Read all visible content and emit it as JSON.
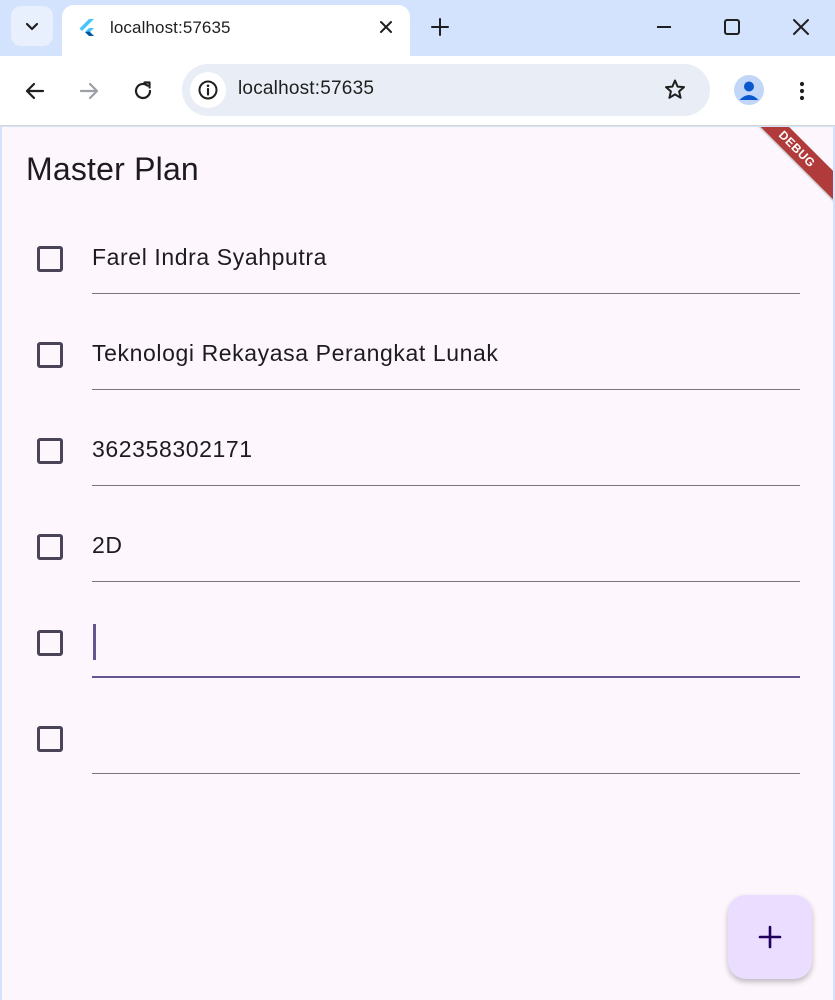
{
  "browser": {
    "tab_title": "localhost:57635",
    "url": "localhost:57635"
  },
  "app": {
    "title": "Master Plan",
    "debug_label": "DEBUG",
    "tasks": [
      {
        "description": "Farel Indra Syahputra",
        "complete": false,
        "focused": false
      },
      {
        "description": "Teknologi Rekayasa Perangkat Lunak",
        "complete": false,
        "focused": false
      },
      {
        "description": "362358302171",
        "complete": false,
        "focused": false
      },
      {
        "description": "2D",
        "complete": false,
        "focused": false
      },
      {
        "description": "",
        "complete": false,
        "focused": true
      },
      {
        "description": "",
        "complete": false,
        "focused": false
      }
    ],
    "fab_icon": "add-icon"
  },
  "colors": {
    "accent": "#65558f",
    "fab_background": "#eaddff",
    "app_background": "#fdf7fd",
    "debug_banner": "#b13a3a"
  }
}
